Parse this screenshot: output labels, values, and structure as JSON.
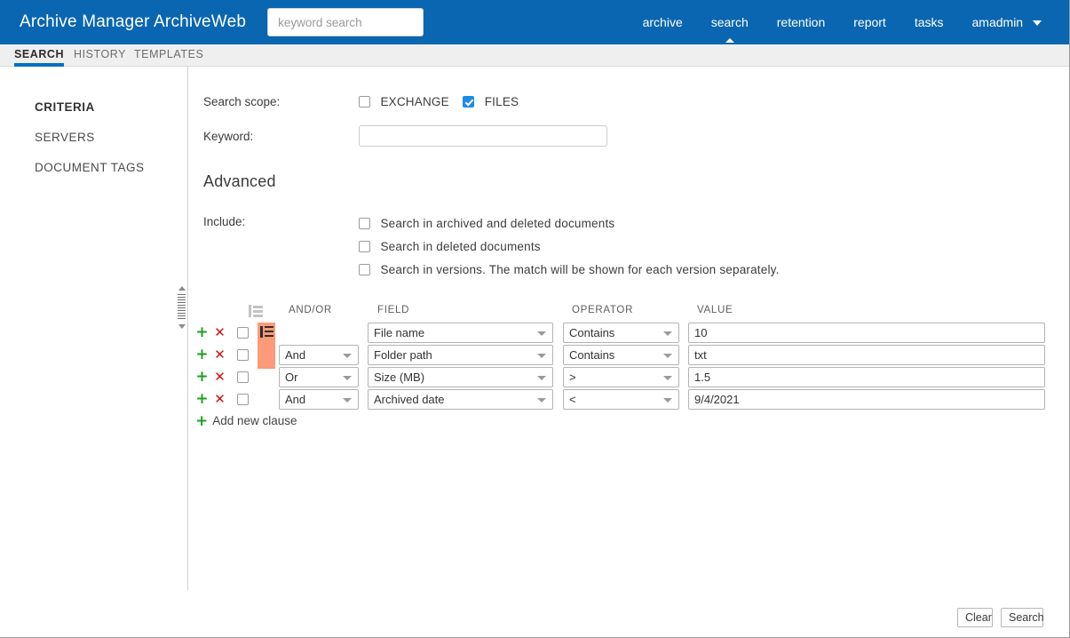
{
  "header": {
    "brand": "Archive Manager ArchiveWeb",
    "search_placeholder": "keyword search",
    "search_value": "",
    "nav": [
      {
        "label": "archive",
        "active": false
      },
      {
        "label": "search",
        "active": true
      },
      {
        "label": "retention",
        "active": false
      },
      {
        "label": "report",
        "active": false
      },
      {
        "label": "tasks",
        "active": false
      },
      {
        "label": "amadmin",
        "active": false,
        "has_caret": true
      }
    ]
  },
  "tabs": [
    {
      "label": "SEARCH",
      "active": true
    },
    {
      "label": "HISTORY",
      "active": false
    },
    {
      "label": "TEMPLATES",
      "active": false
    }
  ],
  "sidebar": {
    "items": [
      {
        "label": "CRITERIA",
        "active": true
      },
      {
        "label": "SERVERS",
        "active": false
      },
      {
        "label": "DOCUMENT TAGS",
        "active": false
      }
    ]
  },
  "form": {
    "scope_label": "Search scope:",
    "scope_options": [
      {
        "label": "EXCHANGE",
        "checked": false
      },
      {
        "label": "FILES",
        "checked": true
      }
    ],
    "keyword_label": "Keyword:",
    "keyword_value": "",
    "keyword_placeholder": "",
    "advanced_heading": "Advanced",
    "include_label": "Include:",
    "include_options": [
      {
        "label": "Search in archived and deleted documents",
        "checked": false
      },
      {
        "label": "Search in deleted documents",
        "checked": false
      },
      {
        "label": "Search in versions. The match will be shown for each version separately.",
        "checked": false
      }
    ]
  },
  "criteria": {
    "columns": {
      "group": "",
      "andor": "AND/OR",
      "field": "FIELD",
      "operator": "OPERATOR",
      "value": "VALUE"
    },
    "group_header_icon": "group-clause-icon",
    "add_icon": "plus-icon",
    "remove_icon": "close-icon",
    "rows": [
      {
        "checked": false,
        "andor": null,
        "field": "File name",
        "operator": "Contains",
        "value": "10",
        "grouped": false
      },
      {
        "checked": false,
        "andor": "And",
        "field": "Folder path",
        "operator": "Contains",
        "value": "txt",
        "grouped": true
      },
      {
        "checked": false,
        "andor": "Or",
        "field": "Size (MB)",
        "operator": ">",
        "value": "1.5",
        "grouped": true
      },
      {
        "checked": false,
        "andor": "And",
        "field": "Archived date",
        "operator": "<",
        "value": "9/4/2021",
        "grouped": false
      }
    ],
    "add_clause_label": "Add new clause",
    "group_color": "#fc9a79"
  },
  "footer": {
    "clear_label": "Clear",
    "search_label": "Search"
  },
  "colors": {
    "brand_blue": "#0a66b0",
    "tab_accent": "#0a6dc2",
    "checkbox_blue": "#1e8ae8",
    "plus_green": "#1f9e1f",
    "remove_red": "#cc1111",
    "group_orange": "#fc9a79"
  }
}
